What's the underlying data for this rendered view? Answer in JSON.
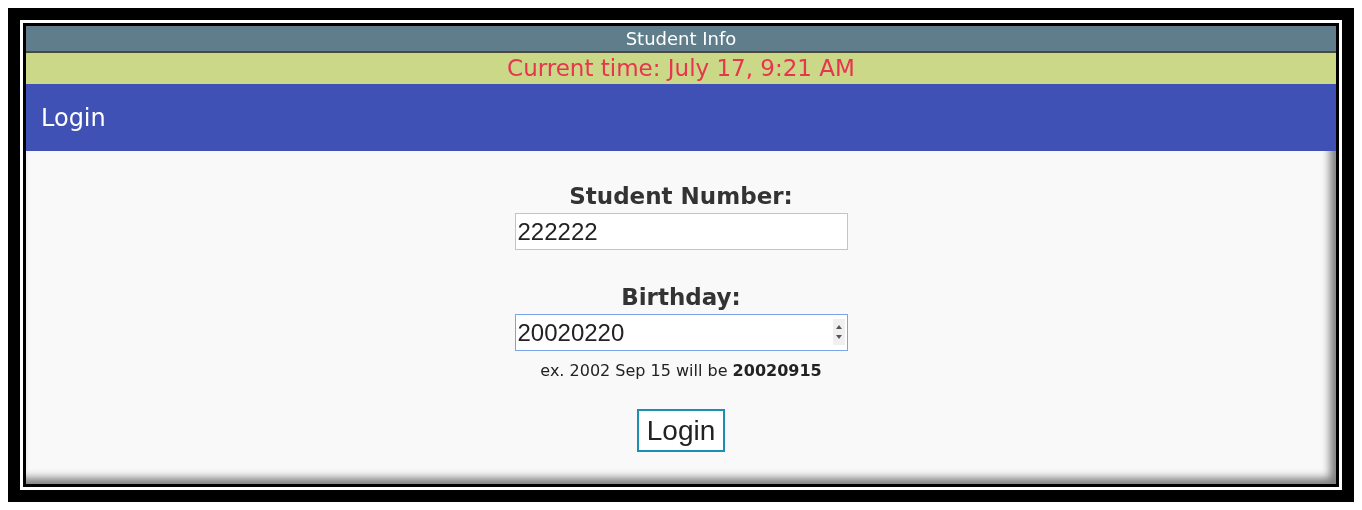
{
  "title_bar": {
    "title": "Student Info"
  },
  "time_bar": {
    "text": "Current time: July 17, 9:21 AM"
  },
  "header": {
    "title": "Login"
  },
  "fields": [
    {
      "kind": "text",
      "label": "Student Number:",
      "value": "222222",
      "focused": false
    },
    {
      "kind": "number",
      "label": "Birthday:",
      "value": "20020220",
      "focused": true,
      "hint": "ex. 2002 Sep 15 will be **20020915**"
    }
  ],
  "submit": {
    "label": "Login"
  }
}
